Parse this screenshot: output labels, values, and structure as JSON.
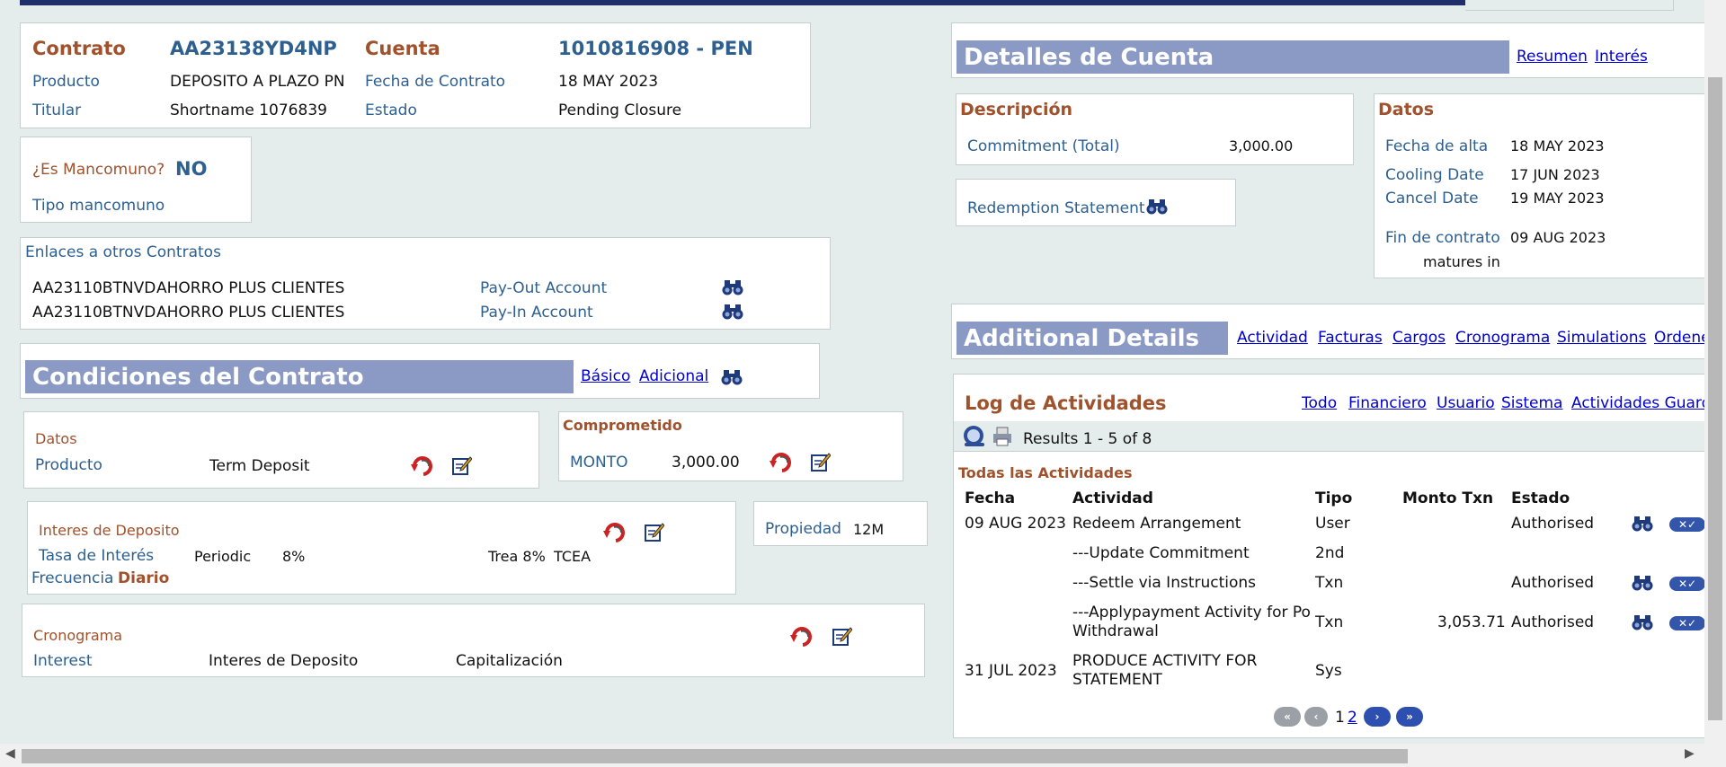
{
  "contract": {
    "contrato_label": "Contrato",
    "contrato_value": "AA23138YD4NP",
    "cuenta_label": "Cuenta",
    "cuenta_value": "1010816908 - PEN",
    "producto_label": "Producto",
    "producto_value": "DEPOSITO A PLAZO PN",
    "fecha_label": "Fecha de Contrato",
    "fecha_value": "18 MAY 2023",
    "titular_label": "Titular",
    "titular_value": "Shortname 1076839",
    "estado_label": "Estado",
    "estado_value": "Pending Closure"
  },
  "mancomuno": {
    "question": "¿Es Mancomuno?",
    "answer": "NO",
    "tipo_label": "Tipo mancomuno"
  },
  "links": {
    "title": "Enlaces a otros Contratos",
    "rows": [
      {
        "id": "AA23110BTNVD",
        "name": "AHORRO PLUS CLIENTES",
        "role": "Pay-Out Account"
      },
      {
        "id": "AA23110BTNVD",
        "name": "AHORRO PLUS CLIENTES",
        "role": "Pay-In Account"
      }
    ]
  },
  "conditions": {
    "title": "Condiciones del Contrato",
    "link_basico": "Básico",
    "link_adicional": "Adicional",
    "datos_title": "Datos",
    "producto_label": "Producto",
    "producto_value": "Term Deposit",
    "comprometido_title": "Comprometido",
    "monto_label": "MONTO",
    "monto_value": "3,000.00",
    "interes_title": "Interes de Deposito",
    "tasa_label": "Tasa de Interés",
    "tasa_type": "Periodic",
    "tasa_value": "8%",
    "trea_value": "Trea 8%",
    "tcea_value": "TCEA",
    "frecuencia_label": "Frecuencia",
    "frecuencia_value": "Diario",
    "propiedad_label": "Propiedad",
    "propiedad_value": "12M",
    "cronograma_title": "Cronograma",
    "interest_label": "Interest",
    "interest_value": "Interes de Deposito",
    "capitalizacion": "Capitalización"
  },
  "account_details": {
    "title": "Detalles de Cuenta",
    "link_resumen": "Resumen",
    "link_interes": "Interés",
    "descripcion_title": "Descripción",
    "commitment_label": "Commitment (Total)",
    "commitment_value": "3,000.00",
    "redemption_label": "Redemption Statement",
    "datos_title": "Datos",
    "fecha_alta_label": "Fecha de alta",
    "fecha_alta_value": "18 MAY 2023",
    "cooling_label": "Cooling Date",
    "cooling_value": "17 JUN 2023",
    "cancel_label": "Cancel Date",
    "cancel_value": "19 MAY 2023",
    "fin_label": "Fin de contrato",
    "fin_value": "09 AUG 2023",
    "matures_label": "matures in"
  },
  "additional": {
    "title": "Additional Details",
    "tabs": [
      "Actividad",
      "Facturas",
      "Cargos",
      "Cronograma",
      "Simulations",
      "Ordene"
    ]
  },
  "log": {
    "title": "Log de Actividades",
    "filters": [
      "Todo",
      "Financiero",
      "Usuario",
      "Sistema",
      "Actividades Guarda"
    ],
    "results": "Results 1 - 5 of 8",
    "section_title": "Todas las Actividades",
    "headers": {
      "fecha": "Fecha",
      "actividad": "Actividad",
      "tipo": "Tipo",
      "monto": "Monto Txn",
      "estado": "Estado"
    },
    "rows": [
      {
        "fecha": "09 AUG 2023",
        "actividad": "Redeem Arrangement",
        "actividad2": "",
        "tipo": "User",
        "monto": "",
        "estado": "Authorised",
        "actions": true
      },
      {
        "fecha": "",
        "actividad": "---Update Commitment",
        "actividad2": "",
        "tipo": "2nd",
        "monto": "",
        "estado": "",
        "actions": false
      },
      {
        "fecha": "",
        "actividad": "---Settle via Instructions",
        "actividad2": "",
        "tipo": "Txn",
        "monto": "",
        "estado": "Authorised",
        "actions": true
      },
      {
        "fecha": "",
        "actividad": "---Applypayment Activity for Po",
        "actividad2": "Withdrawal",
        "tipo": "Txn",
        "monto": "3,053.71",
        "estado": "Authorised",
        "actions": true
      },
      {
        "fecha": "31 JUL 2023",
        "actividad": "PRODUCE ACTIVITY FOR",
        "actividad2": "STATEMENT",
        "tipo": "Sys",
        "monto": "",
        "estado": "",
        "actions": false
      }
    ],
    "pager": {
      "page1": "1",
      "page2": "2"
    }
  }
}
